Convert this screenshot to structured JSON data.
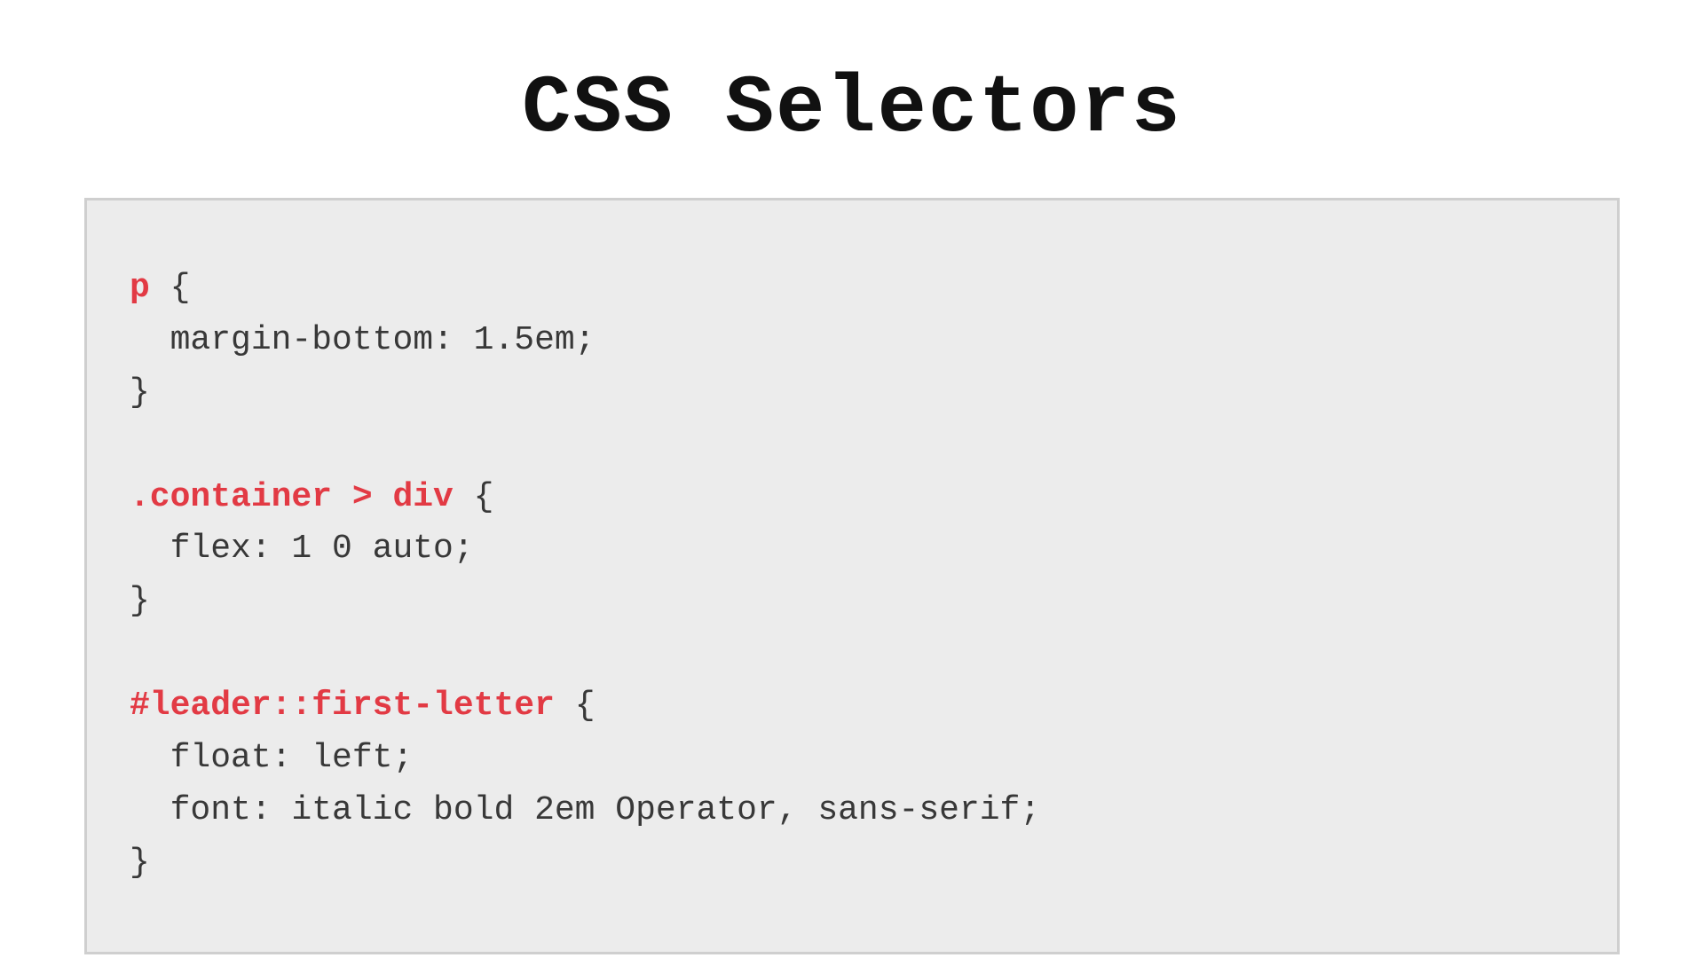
{
  "title": "CSS Selectors",
  "colors": {
    "selector": "#e23a44",
    "text": "#383838",
    "code_bg": "#ececec",
    "code_border": "#cfcfcf",
    "page_bg": "#ffffff"
  },
  "code": {
    "rules": [
      {
        "selector": "p",
        "declarations": [
          {
            "property": "margin-bottom",
            "value": "1.5em"
          }
        ]
      },
      {
        "selector": ".container > div",
        "declarations": [
          {
            "property": "flex",
            "value": "1 0 auto"
          }
        ]
      },
      {
        "selector": "#leader::first-letter",
        "declarations": [
          {
            "property": "float",
            "value": "left"
          },
          {
            "property": "font",
            "value": "italic bold 2em Operator, sans-serif"
          }
        ]
      }
    ]
  },
  "tokens": [
    {
      "cls": "sel",
      "t": "p"
    },
    {
      "cls": "pn",
      "t": " {"
    },
    {
      "nl": true
    },
    {
      "cls": "tx",
      "t": "  margin-bottom: 1.5em;"
    },
    {
      "nl": true
    },
    {
      "cls": "pn",
      "t": "}"
    },
    {
      "nl": true
    },
    {
      "nl": true
    },
    {
      "cls": "sel",
      "t": ".container > div"
    },
    {
      "cls": "pn",
      "t": " {"
    },
    {
      "nl": true
    },
    {
      "cls": "tx",
      "t": "  flex: 1 0 auto;"
    },
    {
      "nl": true
    },
    {
      "cls": "pn",
      "t": "}"
    },
    {
      "nl": true
    },
    {
      "nl": true
    },
    {
      "cls": "sel",
      "t": "#leader::first-letter"
    },
    {
      "cls": "pn",
      "t": " {"
    },
    {
      "nl": true
    },
    {
      "cls": "tx",
      "t": "  float: left;"
    },
    {
      "nl": true
    },
    {
      "cls": "tx",
      "t": "  font: italic bold 2em Operator, sans-serif;"
    },
    {
      "nl": true
    },
    {
      "cls": "pn",
      "t": "}"
    }
  ]
}
